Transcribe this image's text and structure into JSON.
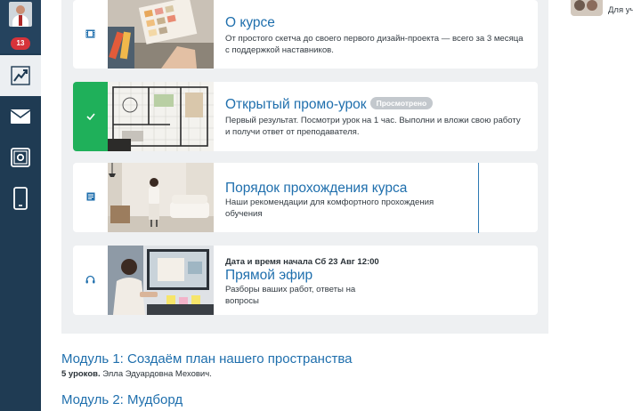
{
  "sidebar": {
    "notification_count": "13",
    "items": [
      {
        "icon": "chart-icon",
        "active": true
      },
      {
        "icon": "mail-icon",
        "active": false
      },
      {
        "icon": "safe-icon",
        "active": false
      },
      {
        "icon": "phone-icon",
        "active": false
      }
    ]
  },
  "lessons": [
    {
      "icon": "film-icon",
      "title": "О курсе",
      "description": "От простого скетча до своего первого дизайн-проекта — всего за 3 месяца с поддержкой наставников."
    },
    {
      "icon": "check-icon",
      "completed": true,
      "title": "Открытый промо-урок",
      "badge": "Просмотрено",
      "description": "Первый результат. Посмотри урок на 1 час. Выполни и вложи свою работу и получи ответ от преподавателя."
    },
    {
      "icon": "document-icon",
      "title": "Порядок прохождения курса",
      "description": "Наши рекомендации для комфортного прохождения обучения"
    },
    {
      "icon": "headphones-icon",
      "eyebrow": "Дата и время начала Сб 23 Авг 12:00",
      "title": "Прямой эфир",
      "description": "Разборы ваших работ, ответы на вопросы"
    }
  ],
  "modules": [
    {
      "title": "Модуль 1: Создаём план нашего пространства",
      "lessons_count": "5 уроков.",
      "author": "Элла Эдуардовна Мехович."
    },
    {
      "title": "Модуль 2: Мудборд"
    }
  ],
  "top_right": {
    "text": "Для уч"
  },
  "colors": {
    "accent": "#1f6fad",
    "sidebar": "#1f3b53",
    "success": "#1fb05a",
    "badge": "#d6333a"
  }
}
